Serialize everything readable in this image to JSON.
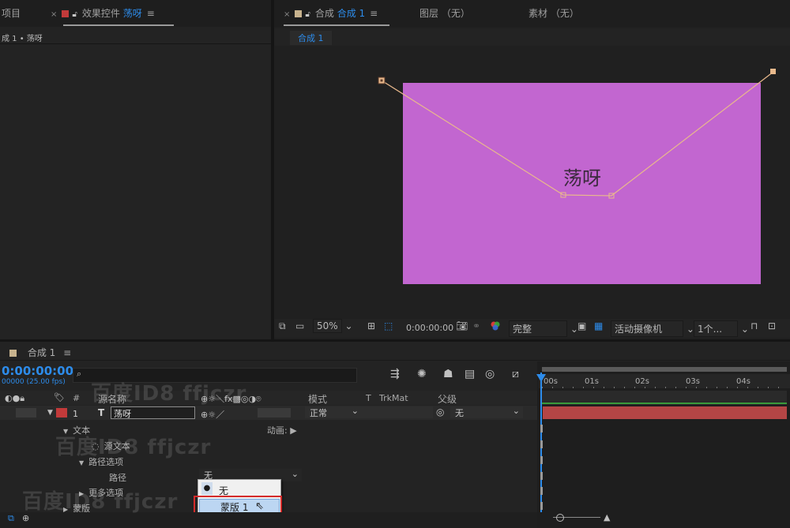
{
  "project_panel": {
    "tab_label": "项目",
    "breadcrumb": "成 1 • 荡呀"
  },
  "effects_panel": {
    "tab_prefix": "效果控件",
    "tab_layer": "荡呀"
  },
  "comp_panel": {
    "tab_prefix": "合成",
    "tab_comp": "合成 1",
    "layer_tab": "图层 （无）",
    "footage_tab": "素材 （无）",
    "comp_pill": "合成 1",
    "canvas_text": "荡呀",
    "canvas_color": "#c266d0",
    "path_color": "#e9b98c"
  },
  "viewer_controls": {
    "zoom": "50%",
    "timecode": "0:00:00:00",
    "resolution": "完整",
    "camera": "活动摄像机",
    "views": "1个..."
  },
  "timeline": {
    "tab_label": "合成 1",
    "current_time": "0:00:00:00",
    "fps_text": "00000 (25.00 fps)",
    "search_placeholder": "",
    "columns": {
      "hash": "#",
      "source_name": "源名称",
      "mode": "模式",
      "t": "T",
      "trkmat": "TrkMat",
      "parent": "父级"
    },
    "layer": {
      "number": "1",
      "type_glyph": "T",
      "name": "荡呀",
      "mode": "正常",
      "parent": "无",
      "color": "#c23a3a"
    },
    "props": {
      "text": "文本",
      "animate": "动画:",
      "source_text": "源文本",
      "path_options": "路径选项",
      "path": "路径",
      "path_value": "无",
      "more_options": "更多选项",
      "masks": "蒙版"
    },
    "ruler": [
      "00s",
      "01s",
      "02s",
      "03s",
      "04s"
    ],
    "bar_color": "#b44545"
  },
  "path_dropdown": {
    "options": [
      {
        "label": "无",
        "selected": true
      },
      {
        "label": "蒙版 1",
        "selected": false,
        "hovered": true
      }
    ],
    "highlight_color": "#d42a2a"
  },
  "watermarks": [
    "百度ID8 ffjczr",
    "百度ID8 ffjczr",
    "百度ID8 ffjczr"
  ]
}
